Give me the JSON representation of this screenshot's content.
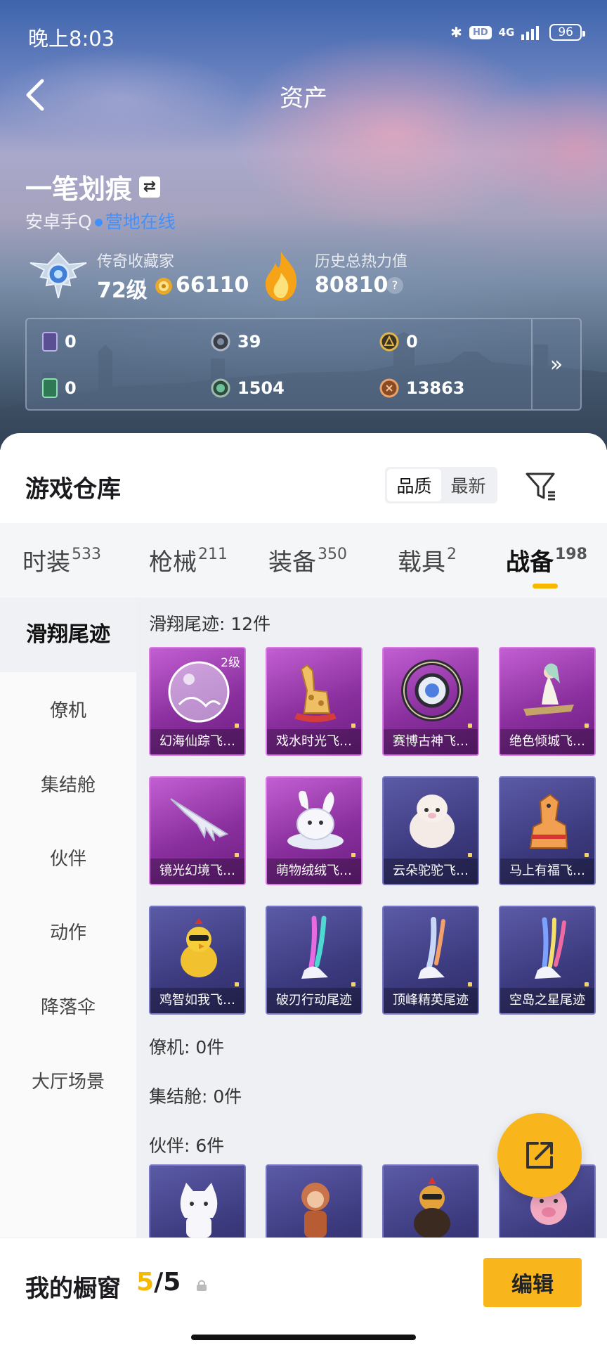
{
  "status": {
    "time": "晚上8:03",
    "hd": "HD",
    "net": "4G",
    "battery": "96"
  },
  "header": {
    "title": "资产"
  },
  "profile": {
    "name": "一笔划痕",
    "swap_icon": "⇄",
    "platform": "安卓手Q",
    "online": "营地在线",
    "collector_label": "传奇收藏家",
    "level": "72级",
    "coins": "66110",
    "heat_label": "历史总热力值",
    "heat_value": "80810",
    "heat_help": "?"
  },
  "resources": [
    {
      "icon": "card-icon",
      "value": "0"
    },
    {
      "icon": "ring-icon",
      "value": "39"
    },
    {
      "icon": "gold-ring-icon",
      "value": "0"
    },
    {
      "icon": "green-card-icon",
      "value": "0"
    },
    {
      "icon": "green-orb-icon",
      "value": "1504"
    },
    {
      "icon": "copper-coin-icon",
      "value": "13863"
    }
  ],
  "resources_more": "»",
  "warehouse": {
    "title": "游戏仓库",
    "sort": [
      "品质",
      "最新"
    ]
  },
  "tabs": [
    {
      "label": "时装",
      "count": "533"
    },
    {
      "label": "枪械",
      "count": "211"
    },
    {
      "label": "装备",
      "count": "350"
    },
    {
      "label": "载具",
      "count": "2"
    },
    {
      "label": "战备",
      "count": "198"
    }
  ],
  "sidebar": [
    "滑翔尾迹",
    "僚机",
    "集结舱",
    "伙伴",
    "动作",
    "降落伞",
    "大厅场景"
  ],
  "sections": {
    "glide": "滑翔尾迹: 12件",
    "wingman": "僚机: 0件",
    "pod": "集结舱: 0件",
    "partner": "伙伴: 6件"
  },
  "items": [
    {
      "name": "幻海仙踪飞…",
      "tier": "purple",
      "level": "2级",
      "icon": "bubble-icon"
    },
    {
      "name": "戏水时光飞…",
      "tier": "purple",
      "icon": "giraffe-icon"
    },
    {
      "name": "赛博古神飞…",
      "tier": "purple",
      "icon": "cyber-ring-icon"
    },
    {
      "name": "绝色倾城飞…",
      "tier": "purple",
      "icon": "lady-icon"
    },
    {
      "name": "镜光幻境飞…",
      "tier": "purple",
      "icon": "wing-icon"
    },
    {
      "name": "萌物绒绒飞…",
      "tier": "purple",
      "icon": "bunny-icon"
    },
    {
      "name": "云朵驼驼飞…",
      "tier": "blue",
      "icon": "alpaca-icon"
    },
    {
      "name": "马上有福飞…",
      "tier": "blue",
      "icon": "horse-icon"
    },
    {
      "name": "鸡智如我飞…",
      "tier": "blue",
      "icon": "chicken-icon"
    },
    {
      "name": "破刃行动尾迹",
      "tier": "blue",
      "icon": "trail-icon"
    },
    {
      "name": "顶峰精英尾迹",
      "tier": "blue",
      "icon": "trail-icon"
    },
    {
      "name": "空岛之星尾迹",
      "tier": "blue",
      "icon": "trail-icon"
    }
  ],
  "partners": [
    {
      "tier": "blue",
      "icon": "cat-icon"
    },
    {
      "tier": "blue",
      "icon": "monkey-icon"
    },
    {
      "tier": "blue",
      "icon": "rooster-icon"
    },
    {
      "tier": "blue",
      "icon": "pig-icon"
    }
  ],
  "showcase": {
    "label": "我的橱窗",
    "count": "5",
    "total": "5",
    "edit": "编辑"
  },
  "colors": {
    "accent": "#f9b61c",
    "online": "#3f91ff",
    "purple": "#8a2f9e",
    "blue": "#3c3a7e"
  }
}
